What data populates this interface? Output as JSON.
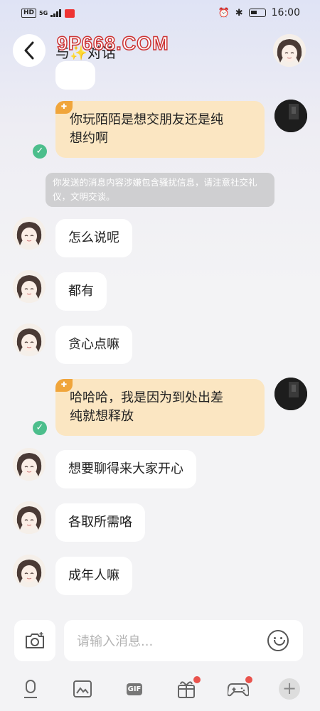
{
  "status_bar": {
    "network": "HD",
    "signal": "5G",
    "time": "16:00"
  },
  "header": {
    "title": "与✨对话",
    "watermark": "9P668.COM"
  },
  "messages": [
    {
      "from": "me",
      "text": "你玩陌陌是想交朋友还是纯想约啊",
      "lines": [
        "你玩陌陌是想交朋友还是纯",
        "想约啊"
      ],
      "status": "sent"
    },
    {
      "from": "system",
      "text": "你发送的消息内容涉嫌包含骚扰信息，请注意社交礼仪，文明交谈。"
    },
    {
      "from": "other",
      "text": "怎么说呢"
    },
    {
      "from": "other",
      "text": "都有"
    },
    {
      "from": "other",
      "text": "贪心点嘛"
    },
    {
      "from": "me",
      "text": "哈哈哈，我是因为到处出差纯就想释放",
      "lines": [
        "哈哈哈，我是因为到处出差",
        "纯就想释放"
      ],
      "status": "sent"
    },
    {
      "from": "other",
      "text": "想要聊得来大家开心"
    },
    {
      "from": "other",
      "text": "各取所需咯"
    },
    {
      "from": "other",
      "text": "成年人嘛"
    }
  ],
  "input": {
    "placeholder": "请输入消息..."
  },
  "toolbar": {
    "items": [
      "voice-icon",
      "image-icon",
      "gif-icon",
      "gift-icon",
      "game-icon",
      "plus-icon"
    ],
    "gif_label": "GIF",
    "plus_label": "+"
  },
  "colors": {
    "my_bubble": "#fbe6c2",
    "their_bubble": "#ffffff",
    "sent_check": "#4cbe8c",
    "badge_dot": "#e9534d"
  }
}
